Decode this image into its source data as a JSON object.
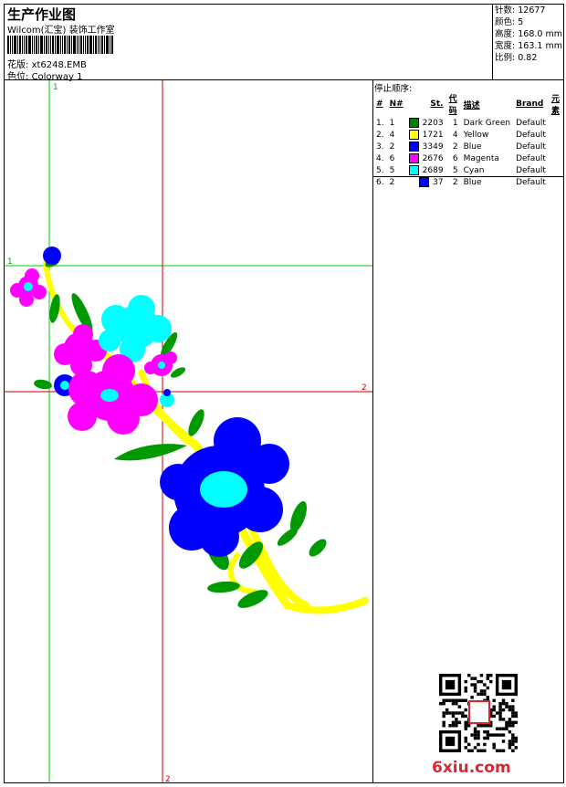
{
  "header": {
    "title": "生产作业图",
    "company": "Wilcom(汇宝) 装饰工作室",
    "design_file_label": "花版:",
    "design_file": "xt6248.EMB",
    "colorway_label": "色位:",
    "colorway": "Colorway 1"
  },
  "stats": {
    "stitches_label": "针数:",
    "stitches": "12677",
    "colors_label": "颜色:",
    "colors": "5",
    "height_label": "高度:",
    "height": "168.0 mm",
    "width_label": "宽度:",
    "width": "163.1 mm",
    "scale_label": "比例:",
    "scale": "0.82"
  },
  "stop_sequence": {
    "title": "停止顺序:",
    "columns": [
      "#",
      "N#",
      "St.",
      "代码",
      "描述",
      "Brand",
      "元素"
    ],
    "rows": [
      {
        "num": "1.",
        "n": "1",
        "color": "#008000",
        "st": "2203",
        "code": "1",
        "desc": "Dark Green",
        "brand": "Default"
      },
      {
        "num": "2.",
        "n": "4",
        "color": "#ffff00",
        "st": "1721",
        "code": "4",
        "desc": "Yellow",
        "brand": "Default"
      },
      {
        "num": "3.",
        "n": "2",
        "color": "#0000ff",
        "st": "3349",
        "code": "2",
        "desc": "Blue",
        "brand": "Default"
      },
      {
        "num": "4.",
        "n": "6",
        "color": "#ff00ff",
        "st": "2676",
        "code": "6",
        "desc": "Magenta",
        "brand": "Default"
      },
      {
        "num": "5.",
        "n": "5",
        "color": "#00ffff",
        "st": "2689",
        "code": "5",
        "desc": "Cyan",
        "brand": "Default"
      },
      {
        "num": "6.",
        "n": "2",
        "color": "#0000ff",
        "st": "37",
        "code": "2",
        "desc": "Blue",
        "brand": "Default"
      }
    ]
  },
  "guides": {
    "v1": "1",
    "h1": "1",
    "h2": "2",
    "v2": "2"
  },
  "watermark": {
    "site": "6xiu.com"
  },
  "palette": {
    "green_guide": "#00cc00",
    "red_guide": "#cc0000",
    "green": "#009900",
    "yellow": "#ffff00",
    "blue": "#0000ff",
    "magenta": "#ff00ff",
    "cyan": "#00ffff"
  }
}
